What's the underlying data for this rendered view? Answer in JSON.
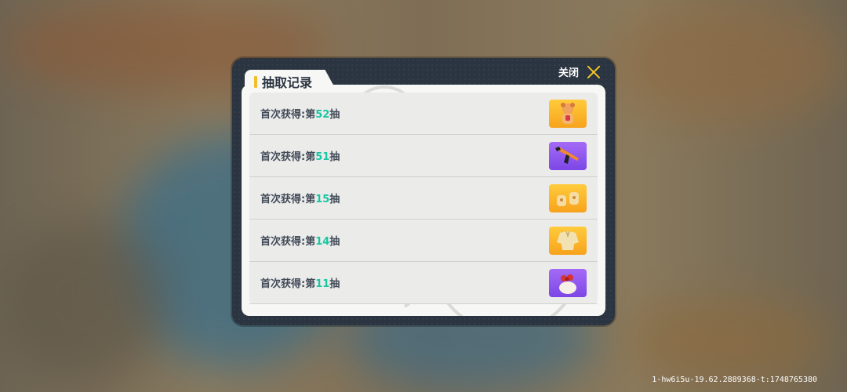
{
  "dialog": {
    "title": "抽取记录",
    "close_label": "关闭"
  },
  "records": [
    {
      "prefix": "首次获得:第",
      "number": "52",
      "suffix": "抽",
      "item_icon": "orange-bear-costume-icon",
      "rarity_color": "#f9b52a"
    },
    {
      "prefix": "首次获得:第",
      "number": "51",
      "suffix": "抽",
      "item_icon": "orange-rifle-icon",
      "rarity_color": "#8f56ee"
    },
    {
      "prefix": "首次获得:第",
      "number": "15",
      "suffix": "抽",
      "item_icon": "paw-gloves-icon",
      "rarity_color": "#f9b52a"
    },
    {
      "prefix": "首次获得:第",
      "number": "14",
      "suffix": "抽",
      "item_icon": "cream-outfit-icon",
      "rarity_color": "#f9b52a"
    },
    {
      "prefix": "首次获得:第",
      "number": "11",
      "suffix": "抽",
      "item_icon": "red-bow-bun-icon",
      "rarity_color": "#8f56ee"
    }
  ],
  "build_id": "1-hw6i5u-19.62.2889368-t:1748765380",
  "colors": {
    "accent_number": "#17c6a2",
    "panel_dark": "#2b3441",
    "close_icon": "#f4c72b"
  }
}
